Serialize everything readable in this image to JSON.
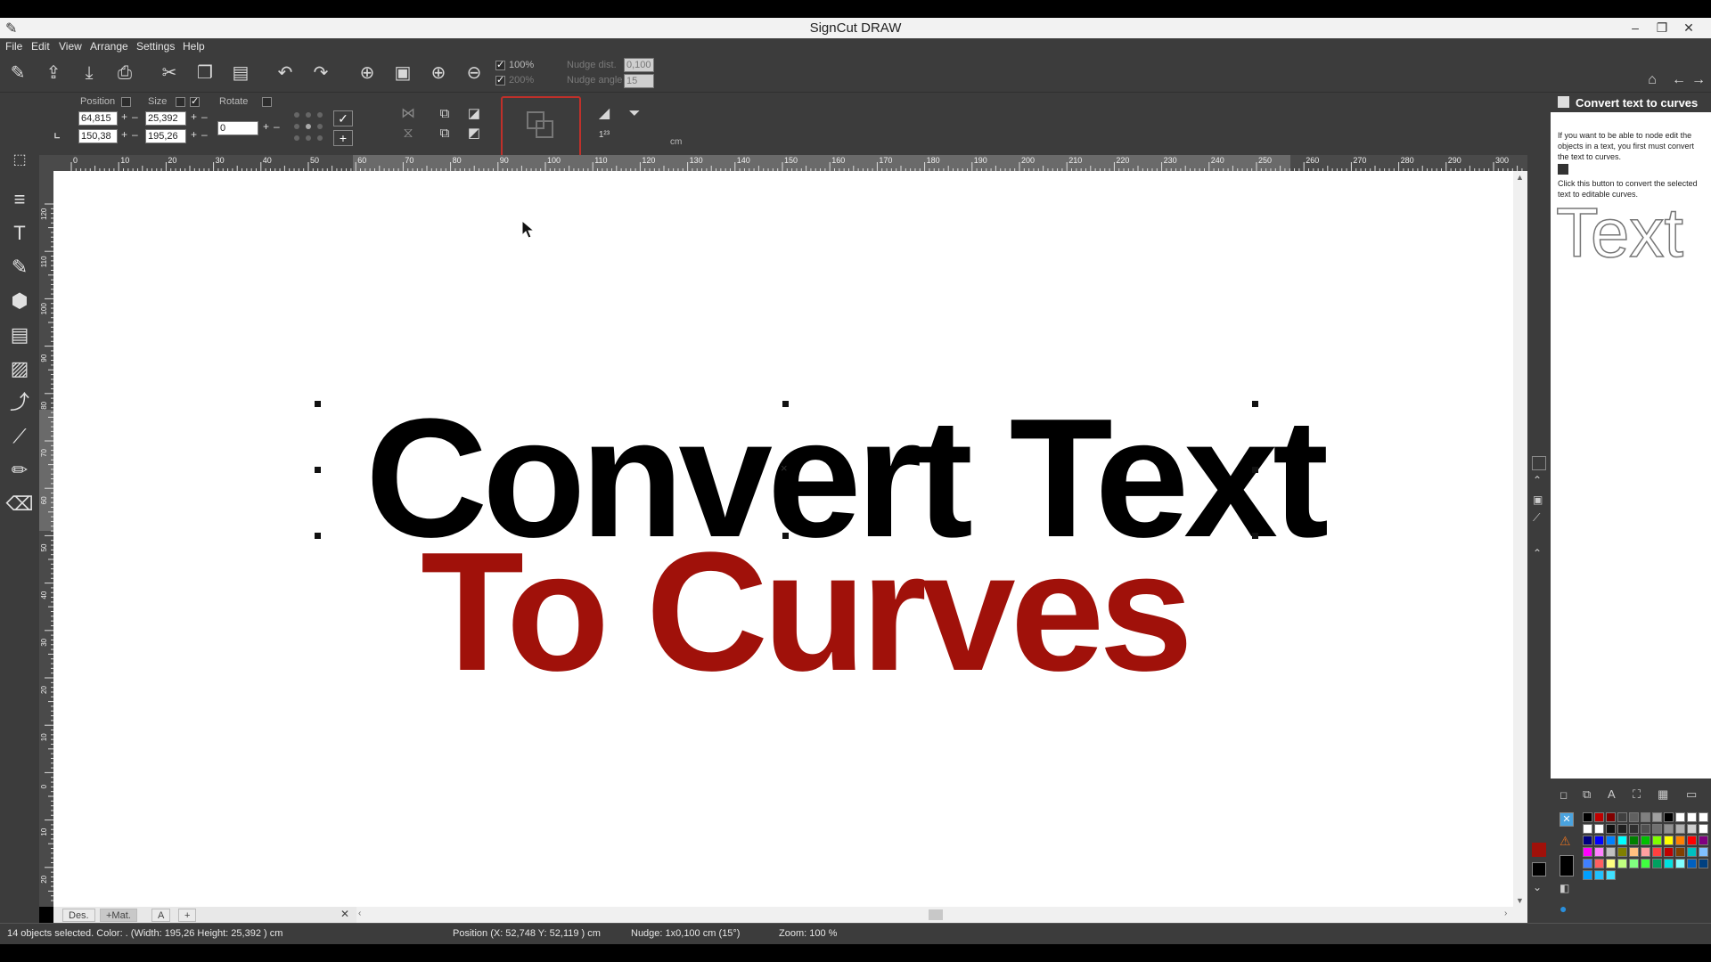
{
  "window": {
    "title": "SignCut DRAW",
    "minimize": "–",
    "restore": "❐",
    "close": "✕"
  },
  "menu": [
    "File",
    "Edit",
    "View",
    "Arrange",
    "Settings",
    "Help"
  ],
  "toolbar1": {
    "zoom_100_label": "100%",
    "zoom_200_label": "200%",
    "nudge_dist_label": "Nudge dist.",
    "nudge_dist_value": "0,100",
    "nudge_angle_label": "Nudge angle",
    "nudge_angle_value": "15"
  },
  "toolbar2": {
    "position_label": "Position",
    "size_label": "Size",
    "rotate_label": "Rotate",
    "pos_x": "64,815",
    "pos_y": "150,38",
    "size_w": "25,392",
    "size_h": "195,26",
    "rotate_value": "0",
    "unit": "cm"
  },
  "ruler_top_ticks": [
    "0",
    "10",
    "20",
    "30",
    "40",
    "50",
    "60",
    "70",
    "80",
    "90",
    "100",
    "110",
    "120",
    "130",
    "140",
    "150",
    "160",
    "170",
    "180",
    "190",
    "200",
    "210",
    "220",
    "230",
    "240",
    "250",
    "260",
    "270",
    "280",
    "290",
    "300"
  ],
  "ruler_left_ticks": [
    "120",
    "110",
    "100",
    "90",
    "80",
    "70",
    "60",
    "50",
    "40",
    "30",
    "20",
    "10",
    "0",
    "10",
    "20"
  ],
  "canvas": {
    "line1": "Convert Text",
    "line2": "To Curves",
    "line1_color": "#000000",
    "line2_color": "#a0110a"
  },
  "help": {
    "title": "Convert text to curves",
    "para1": "If you want to be able to node edit the objects in a text, you first must convert the text to curves.",
    "para2": "Click this button to convert the selected text to editable curves.",
    "sample": "Text"
  },
  "tabs": [
    "Des.",
    "+Mat.",
    "A",
    "+"
  ],
  "status": {
    "selection": "14 objects selected. Color: . (Width: 195,26 Height: 25,392 ) cm",
    "position": "Position (X: 52,748  Y: 52,119 ) cm",
    "nudge": "Nudge: 1x0,100 cm  (15°)",
    "zoom": "Zoom: 100 %"
  },
  "palette_colors": [
    "#000000",
    "#c00000",
    "#800000",
    "#404040",
    "#606060",
    "#808080",
    "#a0a0a0",
    "#000000",
    "#ffffff",
    "#ffffff",
    "#ffffff",
    "#ffffff",
    "#ffffff",
    "#101010",
    "#202020",
    "#303030",
    "#505050",
    "#707070",
    "#909090",
    "#b0b0b0",
    "#d0d0d0",
    "#ffffff",
    "#000080",
    "#0000ff",
    "#0080ff",
    "#00ffff",
    "#008000",
    "#00c000",
    "#80ff00",
    "#ffff00",
    "#ff8000",
    "#ff0000",
    "#800080",
    "#ff00ff",
    "#ff80ff",
    "#c0c0c0",
    "#808000",
    "#ffc080",
    "#ffa0a0",
    "#ff4040",
    "#c00000",
    "#804000",
    "#00c0c0",
    "#80c0ff",
    "#4080ff",
    "#ff6060",
    "#ffff80",
    "#c0ff80",
    "#80ff80",
    "#40ff40",
    "#00a060",
    "#00e0e0",
    "#80ffff",
    "#0060c0",
    "#004080",
    "#00a0ff",
    "#20c0ff",
    "#40e0ff"
  ]
}
